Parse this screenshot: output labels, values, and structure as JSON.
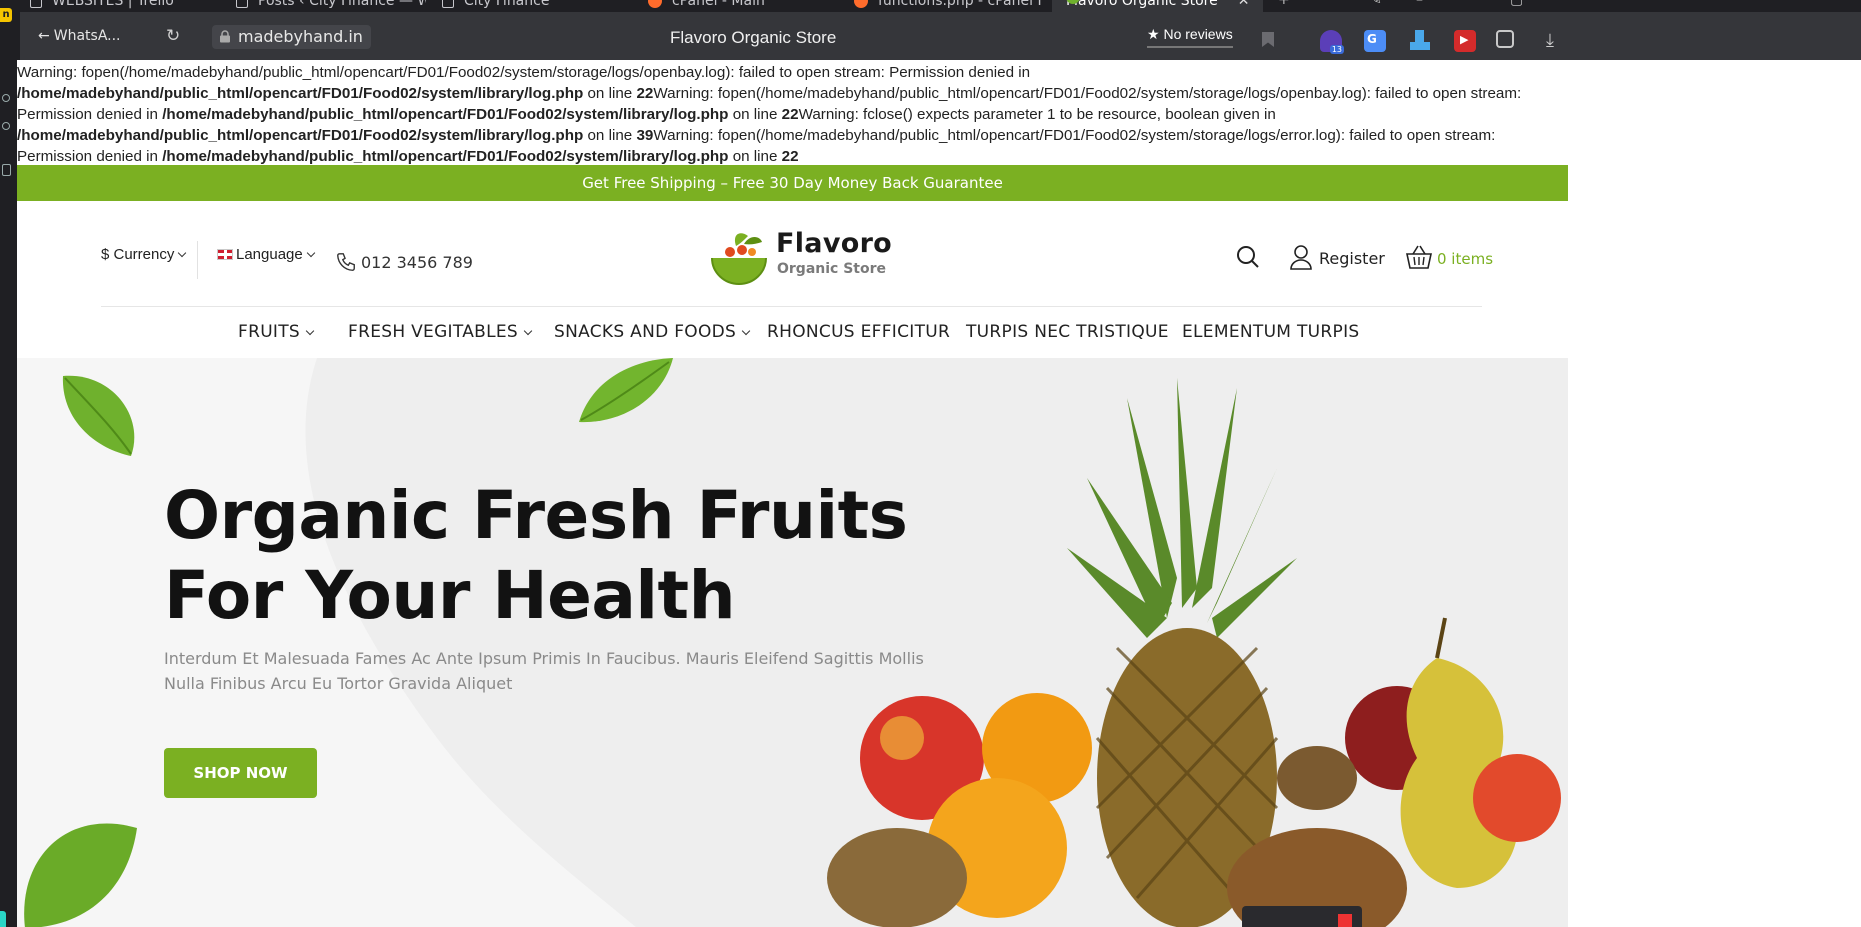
{
  "browser": {
    "tabs": [
      {
        "label": "WEBSITES | Trello"
      },
      {
        "label": "Posts ‹ City Finance — Wo"
      },
      {
        "label": "City Finance"
      },
      {
        "label": "cPanel - Main"
      },
      {
        "label": "functions.php - cPanel File"
      },
      {
        "label": "Flavoro Organic Store",
        "active": true
      }
    ],
    "back_label": "WhatsA...",
    "url": "madebyhand.in",
    "page_title": "Flavoro Organic Store",
    "reviews_label": "No reviews",
    "extension_badge": "13",
    "rail_badge": "n"
  },
  "warning": {
    "lines": [
      {
        "pre": "Warning",
        "text": ": fopen(/home/madebyhand/public_html/opencart/FD01/Food02/system/storage/logs/openbay.log): failed to open stream: Permission denied in"
      },
      {
        "bold": "/home/madebyhand/public_html/opencart/FD01/Food02/system/library/log.php",
        "mid": " on line ",
        "num": "22",
        "pre2": "Warning",
        "text": ": fopen(/home/madebyhand/public_html/opencart/FD01/Food02/system/storage/logs/openbay.log): failed to open stream:"
      },
      {
        "text": "Permission denied in ",
        "bold": "/home/madebyhand/public_html/opencart/FD01/Food02/system/library/log.php",
        "mid": " on line ",
        "num": "22",
        "pre2": "Warning",
        "tail": ": fclose() expects parameter 1 to be resource, boolean given in"
      },
      {
        "bold": "/home/madebyhand/public_html/opencart/FD01/Food02/system/library/log.php",
        "mid": " on line ",
        "num": "39",
        "pre2": "Warning",
        "text": ": fopen(/home/madebyhand/public_html/opencart/FD01/Food02/system/storage/logs/error.log): failed to open stream:"
      },
      {
        "text": "Permission denied in ",
        "bold": "/home/madebyhand/public_html/opencart/FD01/Food02/system/library/log.php",
        "mid": " on line ",
        "num": "22"
      }
    ]
  },
  "promo": "Get Free Shipping – Free 30 Day Money Back Guarantee",
  "header": {
    "currency": "$ Currency",
    "language": "Language",
    "phone": "012 3456 789",
    "logo_name": "Flavoro",
    "logo_sub": "Organic Store",
    "register": "Register",
    "cart": "0 items"
  },
  "nav": {
    "items": [
      {
        "label": "FRUITS",
        "dropdown": true
      },
      {
        "label": "FRESH VEGITABLES",
        "dropdown": true
      },
      {
        "label": "SNACKS AND FOODS",
        "dropdown": true
      },
      {
        "label": "RHONCUS EFFICITUR",
        "dropdown": false
      },
      {
        "label": "TURPIS NEC TRISTIQUE",
        "dropdown": false
      },
      {
        "label": "ELEMENTUM TURPIS",
        "dropdown": false
      }
    ]
  },
  "hero": {
    "title_line1": "Organic Fresh Fruits",
    "title_line2": "For Your Health",
    "desc_line1": "Interdum Et Malesuada Fames Ac Ante Ipsum Primis In Faucibus. Mauris Eleifend Sagittis Mollis",
    "desc_line2": "Nulla Finibus Arcu Eu Tortor Gravida Aliquet",
    "button": "SHOP NOW"
  },
  "colors": {
    "brand_green": "#7bb022",
    "browser_dark": "#35363a"
  }
}
